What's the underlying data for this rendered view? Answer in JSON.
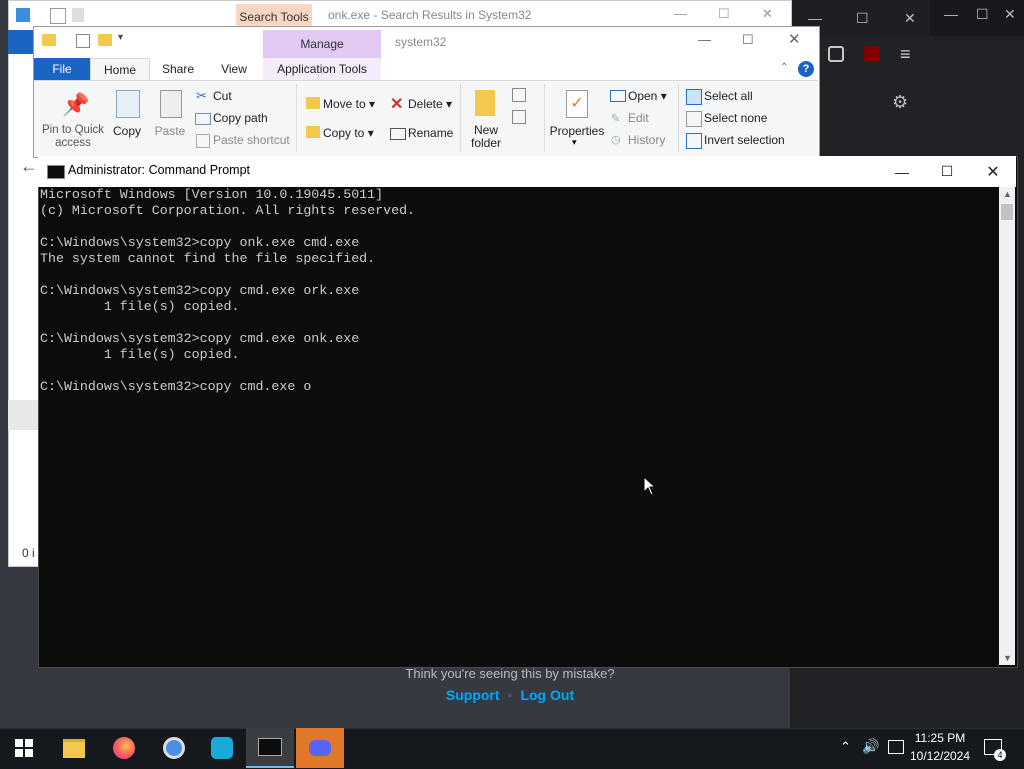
{
  "background_app": {
    "footer_text": "Think you're seeing this by mistake?",
    "support_link": "Support",
    "separator": "•",
    "logout_link": "Log Out"
  },
  "explorer_back": {
    "search_tools": "Search Tools",
    "title": "onk.exe - Search Results in System32",
    "status_prefix": "0 i"
  },
  "explorer_front": {
    "manage_tab": "Manage",
    "title": "system32",
    "tabs": [
      "File",
      "Home",
      "Share",
      "View",
      "Application Tools"
    ],
    "clipboard": {
      "pin": "Pin to Quick access",
      "copy": "Copy",
      "paste": "Paste",
      "cut": "Cut",
      "copy_path": "Copy path",
      "paste_shortcut": "Paste shortcut"
    },
    "organize": {
      "move_to": "Move to",
      "copy_to": "Copy to",
      "delete": "Delete",
      "rename": "Rename"
    },
    "new": {
      "new_folder": "New folder"
    },
    "open": {
      "properties": "Properties",
      "open": "Open",
      "edit": "Edit",
      "history": "History"
    },
    "select": {
      "select_all": "Select all",
      "select_none": "Select none",
      "invert_selection": "Invert selection"
    }
  },
  "cmd": {
    "title": "Administrator: Command Prompt",
    "lines": [
      "Microsoft Windows [Version 10.0.19045.5011]",
      "(c) Microsoft Corporation. All rights reserved.",
      "",
      "C:\\Windows\\system32>copy onk.exe cmd.exe",
      "The system cannot find the file specified.",
      "",
      "C:\\Windows\\system32>copy cmd.exe ork.exe",
      "        1 file(s) copied.",
      "",
      "C:\\Windows\\system32>copy cmd.exe onk.exe",
      "        1 file(s) copied.",
      "",
      "C:\\Windows\\system32>copy cmd.exe o"
    ]
  },
  "taskbar": {
    "time": "11:25 PM",
    "date": "10/12/2024",
    "notification_count": "4",
    "apps": [
      "start-icon",
      "file-explorer-icon",
      "firefox-icon",
      "chrome-icon",
      "vpn-icon",
      "terminal-icon",
      "discord-icon"
    ]
  },
  "colors": {
    "file_tab": "#1a64c4",
    "manage_tab": "#e2c9f3",
    "search_tools_tab": "#f7d7c4",
    "cmd_bg": "#0c0c0c",
    "cmd_text": "#cccccc",
    "link": "#00a8fc",
    "discord_highlight": "#e0772a"
  }
}
